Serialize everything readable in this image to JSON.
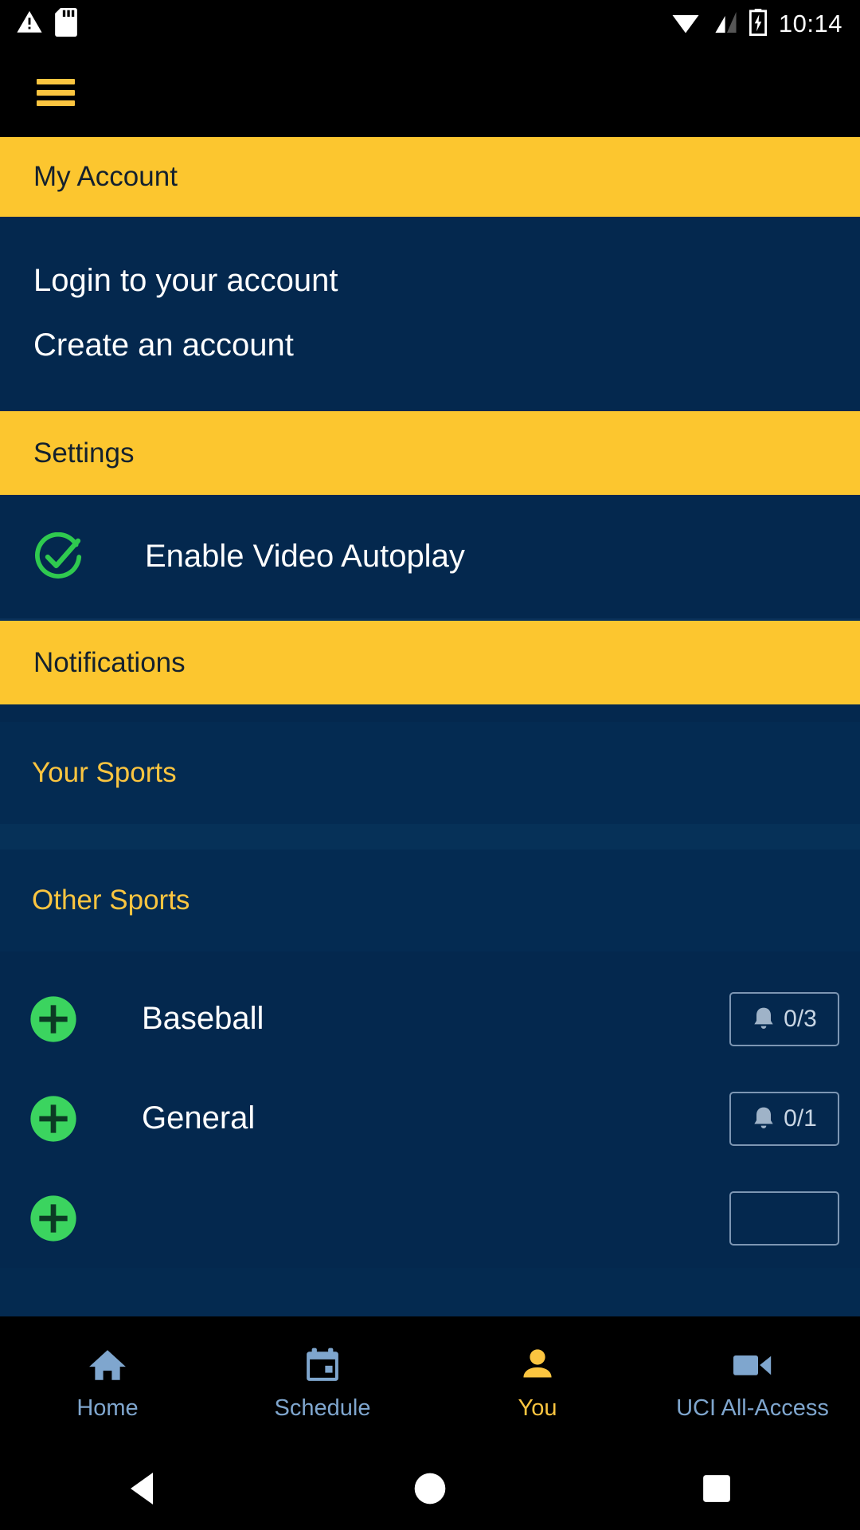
{
  "status_bar": {
    "time": "10:14",
    "icons": [
      "warning-triangle-icon",
      "sd-card-icon",
      "wifi-icon",
      "cell-signal-icon",
      "battery-charging-icon"
    ]
  },
  "app_bar": {
    "menu_icon": "hamburger-menu-icon"
  },
  "sections": {
    "my_account": {
      "header": "My Account",
      "links": [
        {
          "label": "Login to your account"
        },
        {
          "label": "Create an account"
        }
      ]
    },
    "settings": {
      "header": "Settings",
      "options": [
        {
          "label": "Enable Video Autoplay",
          "icon": "check-circle-icon",
          "checked": true
        }
      ]
    },
    "notifications": {
      "header": "Notifications",
      "groups": [
        {
          "label": "Your Sports",
          "items": []
        },
        {
          "label": "Other Sports",
          "items": [
            {
              "name": "Baseball",
              "icon": "plus-circle-icon",
              "badge_icon": "bell-icon",
              "badge": "0/3"
            },
            {
              "name": "General",
              "icon": "plus-circle-icon",
              "badge_icon": "bell-icon",
              "badge": "0/1"
            }
          ]
        }
      ]
    }
  },
  "tab_bar": {
    "tabs": [
      {
        "label": "Home",
        "icon": "home-icon",
        "active": false
      },
      {
        "label": "Schedule",
        "icon": "calendar-icon",
        "active": false
      },
      {
        "label": "You",
        "icon": "person-icon",
        "active": true
      },
      {
        "label": "UCI All-Access",
        "icon": "video-camera-icon",
        "active": false
      }
    ]
  },
  "system_nav": {
    "buttons": [
      {
        "name": "back-button",
        "icon": "triangle-back-icon"
      },
      {
        "name": "home-button",
        "icon": "circle-home-icon"
      },
      {
        "name": "recents-button",
        "icon": "square-recents-icon"
      }
    ]
  },
  "colors": {
    "accent_yellow": "#FCC62F",
    "navy": "#04284E",
    "navy_dark": "#042B52",
    "green": "#3BD45F",
    "tab_inactive": "#7FA6CE",
    "black": "#000000"
  }
}
